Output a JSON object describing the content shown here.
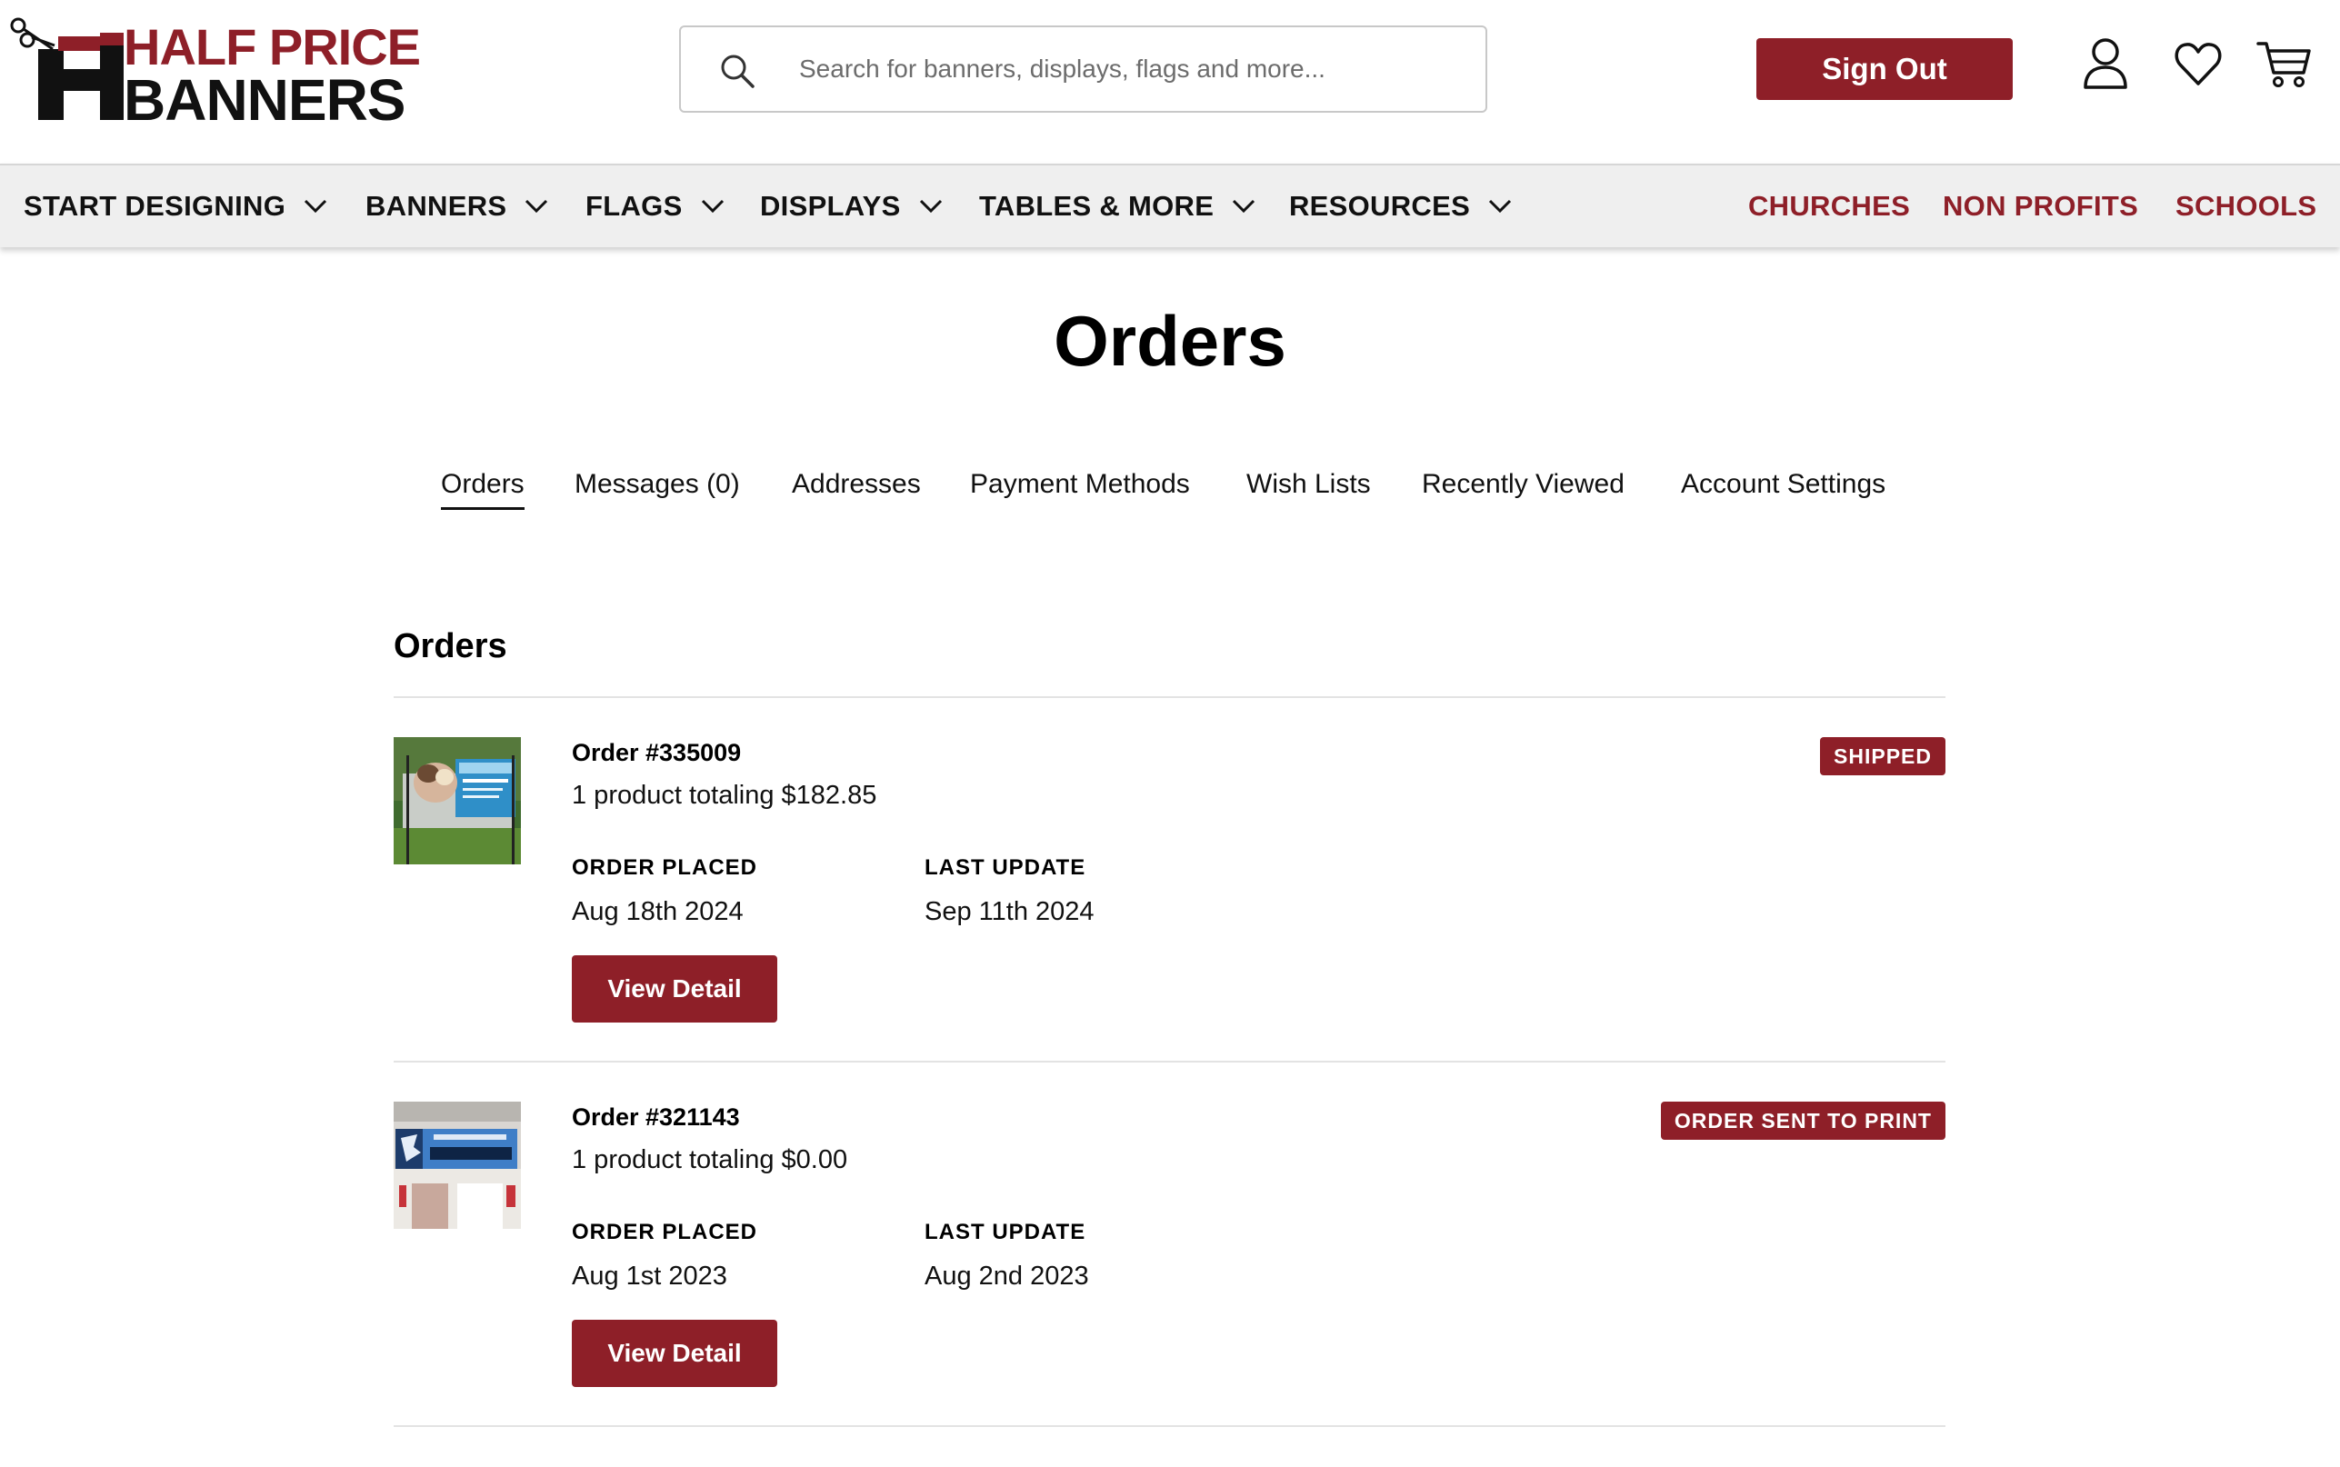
{
  "brand": {
    "line1": "HALF PRICE",
    "line2": "BANNERS"
  },
  "search": {
    "placeholder": "Search for banners, displays, flags and more..."
  },
  "header": {
    "signout_label": "Sign Out"
  },
  "nav": {
    "items": [
      {
        "label": "START DESIGNING"
      },
      {
        "label": "BANNERS"
      },
      {
        "label": "FLAGS"
      },
      {
        "label": "DISPLAYS"
      },
      {
        "label": "TABLES & MORE"
      },
      {
        "label": "RESOURCES"
      }
    ],
    "right_items": [
      {
        "label": "CHURCHES"
      },
      {
        "label": "NON PROFITS"
      },
      {
        "label": "SCHOOLS"
      }
    ]
  },
  "page": {
    "title": "Orders"
  },
  "tabs": [
    {
      "label": "Orders"
    },
    {
      "label": "Messages (0)"
    },
    {
      "label": "Addresses"
    },
    {
      "label": "Payment Methods"
    },
    {
      "label": "Wish Lists"
    },
    {
      "label": "Recently Viewed"
    },
    {
      "label": "Account Settings"
    }
  ],
  "orders_section": {
    "title": "Orders",
    "placed_label": "ORDER PLACED",
    "update_label": "LAST UPDATE",
    "detail_label": "View Detail"
  },
  "orders": [
    {
      "number": "Order #335009",
      "summary": "1 product totaling $182.85",
      "placed": "Aug 18th 2024",
      "updated": "Sep 11th 2024",
      "status": "SHIPPED"
    },
    {
      "number": "Order #321143",
      "summary": "1 product totaling $0.00",
      "placed": "Aug 1st 2023",
      "updated": "Aug 2nd 2023",
      "status": "ORDER SENT TO PRINT"
    }
  ],
  "colors": {
    "brand": "#8e1f28",
    "nav_bg": "#efefef",
    "divider": "#e3e3e3"
  }
}
